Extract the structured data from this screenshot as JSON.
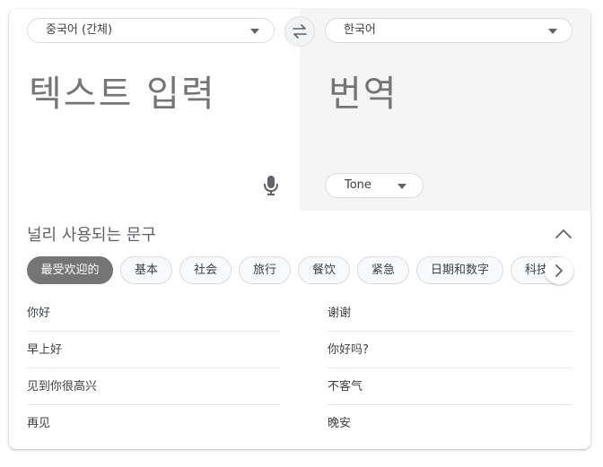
{
  "translate": {
    "source_lang": "중국어 (간체)",
    "target_lang": "한국어",
    "source_placeholder": "텍스트 입력",
    "target_placeholder": "번역",
    "tone_label": "Tone"
  },
  "phrases": {
    "title": "널리 사용되는 문구",
    "chips": [
      "最受欢迎的",
      "基本",
      "社会",
      "旅行",
      "餐饮",
      "紧急",
      "日期和数字",
      "科技"
    ],
    "active_chip": "最受欢迎的",
    "left": [
      "你好",
      "早上好",
      "见到你很高兴",
      "再见"
    ],
    "right": [
      "谢谢",
      "你好吗?",
      "不客气",
      "晚安"
    ]
  },
  "icons": {
    "swap": "swap-arrows-icon",
    "mic": "microphone-icon",
    "collapse": "chevron-up-icon",
    "next": "chevron-right-icon"
  }
}
